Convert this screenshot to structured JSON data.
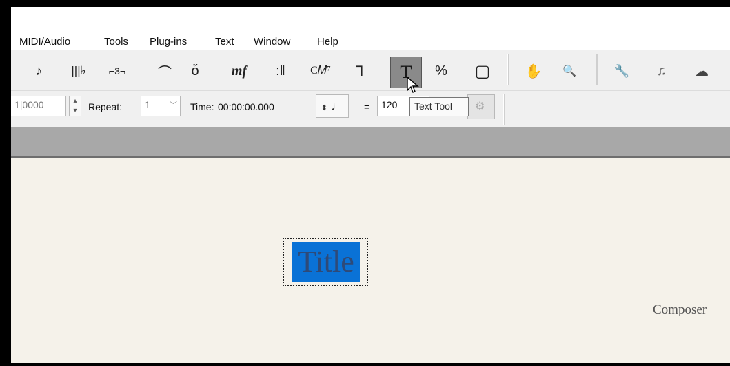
{
  "menu": {
    "items": [
      "MIDI/Audio",
      "Tools",
      "Plug-ins",
      "Text",
      "Window",
      "Help"
    ]
  },
  "toolbar": {
    "tools": [
      {
        "icon": "eighth-note-icon",
        "glyph": "♪"
      },
      {
        "icon": "mixer-icon",
        "glyph": "|||♭"
      },
      {
        "icon": "tuplet-icon",
        "glyph": "⌐3¬"
      },
      {
        "icon": "slur-icon",
        "glyph": "⌒"
      },
      {
        "icon": "articulation-icon",
        "glyph": "ὅ"
      },
      {
        "icon": "dynamics-icon",
        "glyph": "mf"
      },
      {
        "icon": "repeat-icon",
        "glyph": ":‖"
      },
      {
        "icon": "chord-icon",
        "glyph": "C𝑀⁷"
      },
      {
        "icon": "lyrics-icon",
        "glyph": "Ꞁ"
      },
      {
        "icon": "text-tool-icon",
        "glyph": "T"
      },
      {
        "icon": "percent-icon",
        "glyph": "%"
      },
      {
        "icon": "page-icon",
        "glyph": "▢"
      },
      {
        "icon": "hand-icon",
        "glyph": "✋"
      },
      {
        "icon": "zoom-icon",
        "glyph": "🔍"
      },
      {
        "icon": "wrench-icon",
        "glyph": "🔧"
      },
      {
        "icon": "note-entry-icon",
        "glyph": "♫"
      },
      {
        "icon": "sound-icon",
        "glyph": "☁"
      }
    ],
    "active_tool": "Text Tool"
  },
  "propbar": {
    "measure_value": "1|0000",
    "repeat_label": "Repeat:",
    "repeat_value": "1",
    "time_label": "Time:",
    "time_value": "00:00:00.000",
    "equals": "=",
    "tempo_value": "120"
  },
  "tooltip": {
    "text": "Text Tool"
  },
  "score": {
    "title": "Title",
    "composer": "Composer"
  },
  "colors": {
    "selection_highlight": "#0a72d6",
    "paper": "#f5f2ea",
    "toolbar_bg": "#f0f0f0"
  }
}
